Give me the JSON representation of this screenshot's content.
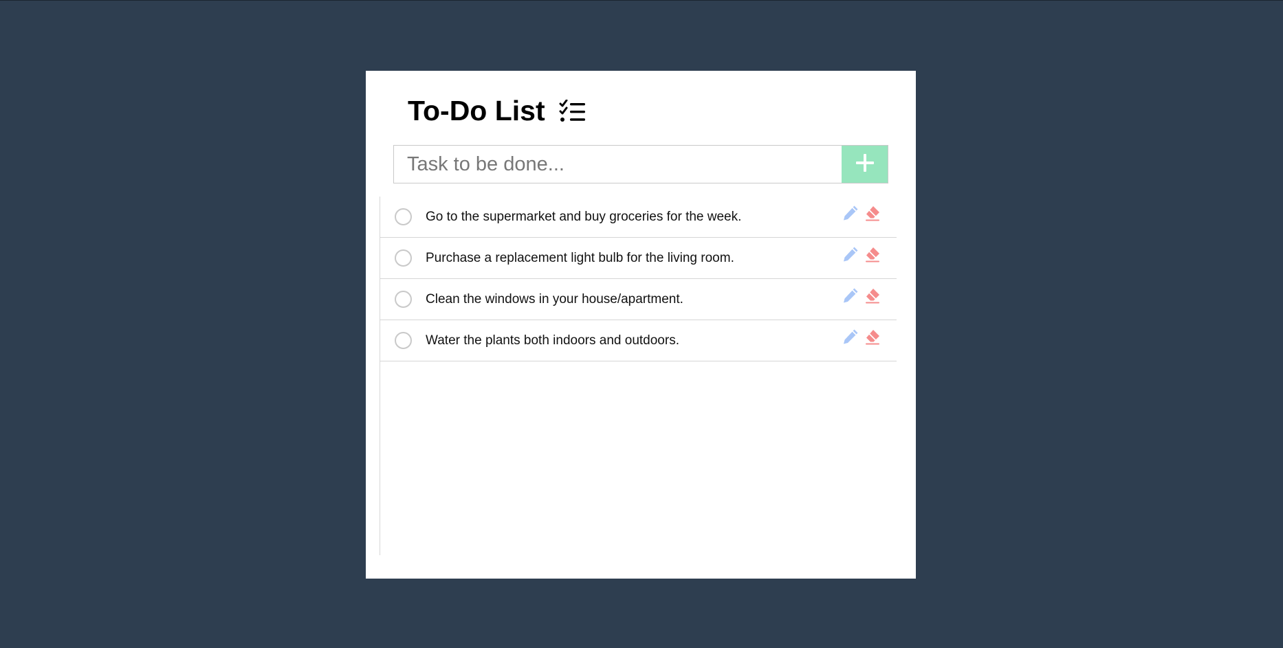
{
  "title": "To-Do List",
  "input": {
    "placeholder": "Task to be done...",
    "value": ""
  },
  "icons": {
    "title": "checklist-icon",
    "add": "plus-icon",
    "edit": "pencil-icon",
    "delete": "eraser-icon",
    "checkbox": "circle-outline"
  },
  "tasks": [
    {
      "text": "Go to the supermarket and buy groceries for the week.",
      "done": false
    },
    {
      "text": "Purchase a replacement light bulb for the living room.",
      "done": false
    },
    {
      "text": "Clean the windows in your house/apartment.",
      "done": false
    },
    {
      "text": "Water the plants both indoors and outdoors.",
      "done": false
    }
  ],
  "colors": {
    "background": "#2e3e50",
    "card": "#ffffff",
    "add_button": "#96e5bd",
    "edit_icon": "#a9c6f7",
    "delete_icon": "#f58c8c",
    "checkbox_border": "#c9c9c9",
    "divider": "#d6d6d6"
  }
}
